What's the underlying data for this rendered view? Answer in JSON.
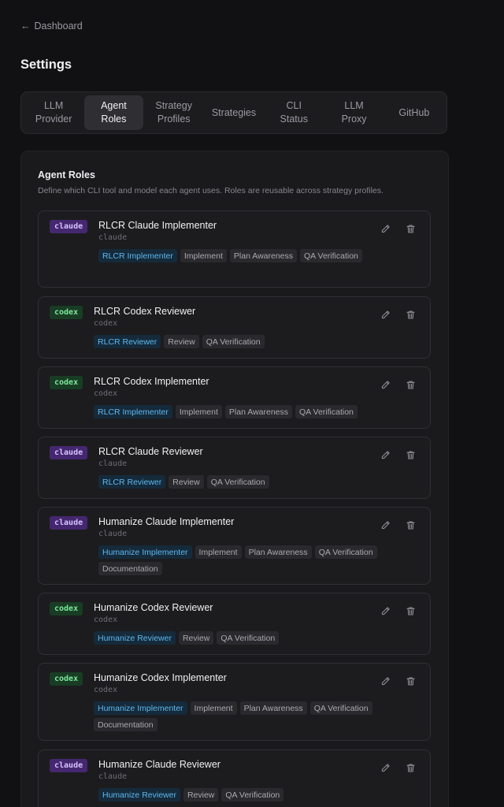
{
  "nav": {
    "back_label": "Dashboard"
  },
  "page": {
    "title": "Settings"
  },
  "tabs": [
    {
      "label": "LLM\nProvider",
      "active": false
    },
    {
      "label": "Agent\nRoles",
      "active": true
    },
    {
      "label": "Strategy\nProfiles",
      "active": false
    },
    {
      "label": "Strategies",
      "active": false
    },
    {
      "label": "CLI\nStatus",
      "active": false
    },
    {
      "label": "LLM\nProxy",
      "active": false
    },
    {
      "label": "GitHub",
      "active": false
    }
  ],
  "panel": {
    "title": "Agent Roles",
    "description": "Define which CLI tool and model each agent uses. Roles are reusable across strategy profiles."
  },
  "colors": {
    "claude_badge_bg": "#45276f",
    "codex_badge_bg": "#183d24",
    "primary_tag_text": "#5fb7ef"
  },
  "roles": [
    {
      "tool": "claude",
      "name": "RLCR Claude Implementer",
      "sub": "claude",
      "tags": [
        "RLCR Implementer",
        "Implement",
        "Plan Awareness",
        "QA Verification"
      ]
    },
    {
      "tool": "codex",
      "name": "RLCR Codex Reviewer",
      "sub": "codex",
      "tags": [
        "RLCR Reviewer",
        "Review",
        "QA Verification"
      ]
    },
    {
      "tool": "codex",
      "name": "RLCR Codex Implementer",
      "sub": "codex",
      "tags": [
        "RLCR Implementer",
        "Implement",
        "Plan Awareness",
        "QA Verification"
      ]
    },
    {
      "tool": "claude",
      "name": "RLCR Claude Reviewer",
      "sub": "claude",
      "tags": [
        "RLCR Reviewer",
        "Review",
        "QA Verification"
      ]
    },
    {
      "tool": "claude",
      "name": "Humanize Claude Implementer",
      "sub": "claude",
      "tags": [
        "Humanize Implementer",
        "Implement",
        "Plan Awareness",
        "QA Verification",
        "Documentation"
      ]
    },
    {
      "tool": "codex",
      "name": "Humanize Codex Reviewer",
      "sub": "codex",
      "tags": [
        "Humanize Reviewer",
        "Review",
        "QA Verification"
      ]
    },
    {
      "tool": "codex",
      "name": "Humanize Codex Implementer",
      "sub": "codex",
      "tags": [
        "Humanize Implementer",
        "Implement",
        "Plan Awareness",
        "QA Verification",
        "Documentation"
      ]
    },
    {
      "tool": "claude",
      "name": "Humanize Claude Reviewer",
      "sub": "claude",
      "tags": [
        "Humanize Reviewer",
        "Review",
        "QA Verification"
      ]
    }
  ]
}
